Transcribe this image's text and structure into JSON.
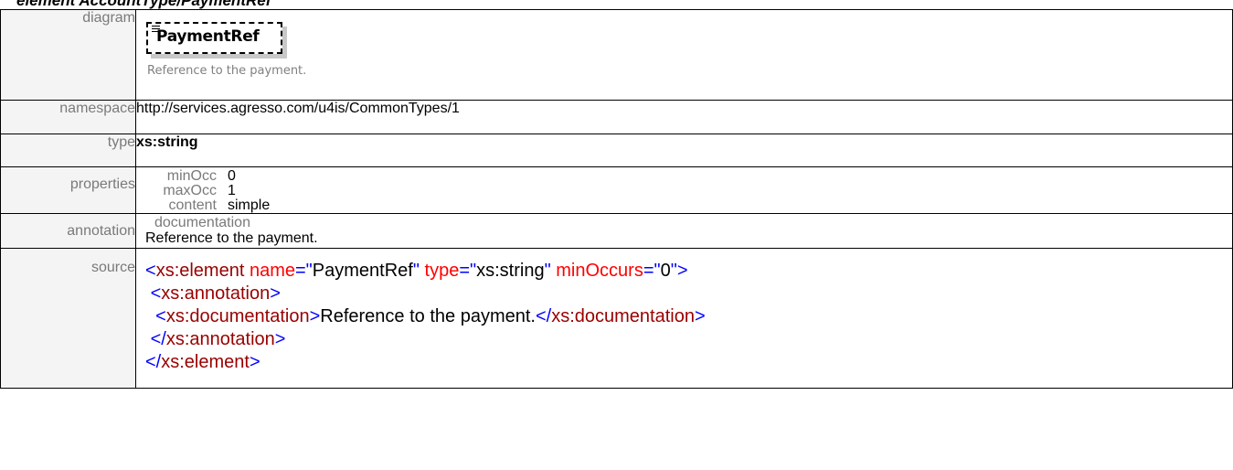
{
  "heading": "element AccountType/PaymentRef",
  "rows": {
    "diagram": {
      "label": "diagram",
      "element_name": "PaymentRef",
      "documentation": "Reference to the payment."
    },
    "namespace": {
      "label": "namespace",
      "value": "http://services.agresso.com/u4is/CommonTypes/1"
    },
    "type": {
      "label": "type",
      "value": "xs:string"
    },
    "properties": {
      "label": "properties",
      "items": [
        {
          "key": "minOcc",
          "value": "0"
        },
        {
          "key": "maxOcc",
          "value": "1"
        },
        {
          "key": "content",
          "value": "simple"
        }
      ]
    },
    "annotation": {
      "label": "annotation",
      "key": "documentation",
      "value": "Reference to the payment."
    },
    "source": {
      "label": "source",
      "lines": [
        [
          {
            "t": "<",
            "c": "bl"
          },
          {
            "t": "xs:element",
            "c": "mr"
          },
          {
            "t": " ",
            "c": "bk"
          },
          {
            "t": "name",
            "c": "rd"
          },
          {
            "t": "=\"",
            "c": "bl"
          },
          {
            "t": "PaymentRef",
            "c": "bk"
          },
          {
            "t": "\"",
            "c": "bl"
          },
          {
            "t": " ",
            "c": "bk"
          },
          {
            "t": "type",
            "c": "rd"
          },
          {
            "t": "=\"",
            "c": "bl"
          },
          {
            "t": "xs:string",
            "c": "bk"
          },
          {
            "t": "\"",
            "c": "bl"
          },
          {
            "t": " ",
            "c": "bk"
          },
          {
            "t": "minOccurs",
            "c": "rd"
          },
          {
            "t": "=\"",
            "c": "bl"
          },
          {
            "t": "0",
            "c": "bk"
          },
          {
            "t": "\"",
            "c": "bl"
          },
          {
            "t": ">",
            "c": "bl"
          }
        ],
        [
          {
            "t": " ",
            "c": "bk"
          },
          {
            "t": "<",
            "c": "bl"
          },
          {
            "t": "xs:annotation",
            "c": "mr"
          },
          {
            "t": ">",
            "c": "bl"
          }
        ],
        [
          {
            "t": "  ",
            "c": "bk"
          },
          {
            "t": "<",
            "c": "bl"
          },
          {
            "t": "xs:documentation",
            "c": "mr"
          },
          {
            "t": ">",
            "c": "bl"
          },
          {
            "t": "Reference to the payment.",
            "c": "bk"
          },
          {
            "t": "</",
            "c": "bl"
          },
          {
            "t": "xs:documentation",
            "c": "mr"
          },
          {
            "t": ">",
            "c": "bl"
          }
        ],
        [
          {
            "t": " ",
            "c": "bk"
          },
          {
            "t": "</",
            "c": "bl"
          },
          {
            "t": "xs:annotation",
            "c": "mr"
          },
          {
            "t": ">",
            "c": "bl"
          }
        ],
        [
          {
            "t": "</",
            "c": "bl"
          },
          {
            "t": "xs:element",
            "c": "mr"
          },
          {
            "t": ">",
            "c": "bl"
          }
        ]
      ]
    }
  }
}
